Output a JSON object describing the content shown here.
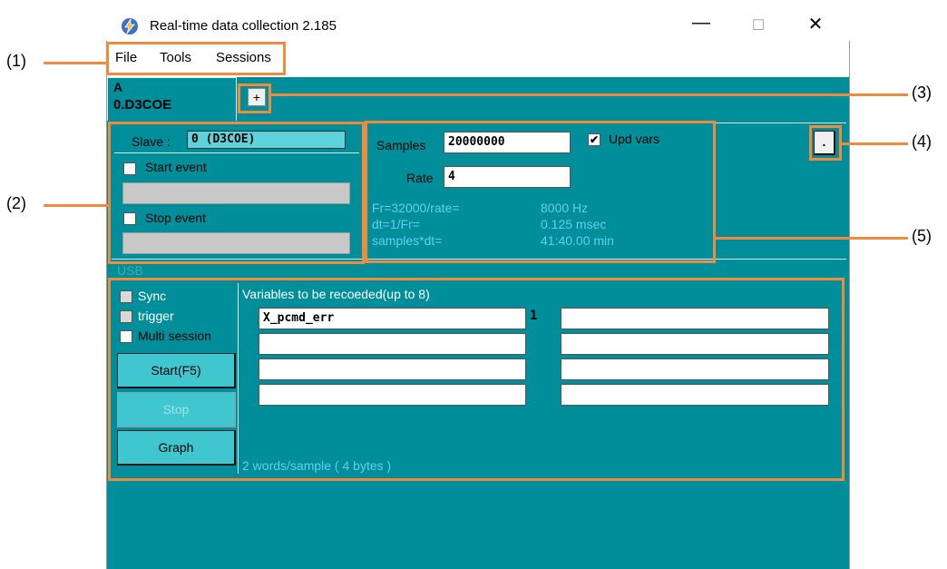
{
  "window": {
    "title": "Real-time data collection 2.185",
    "min_glyph": "—",
    "max_glyph": "☐",
    "close_glyph": "✕"
  },
  "menu": [
    "File",
    "Tools",
    "Sessions"
  ],
  "tabs": [
    {
      "line1": "A",
      "line2": "0.D3COE"
    }
  ],
  "tab_add_label": "+",
  "slave": {
    "label": "Slave :",
    "value": "0 (D3COE)"
  },
  "start_event": {
    "label": "Start event",
    "checked": false
  },
  "stop_event": {
    "label": "Stop event",
    "checked": false
  },
  "usb_label": "USB",
  "samples": {
    "label": "Samples",
    "value": "20000000"
  },
  "rate": {
    "label": "Rate",
    "value": "4"
  },
  "upd_vars": {
    "label": "Upd vars",
    "checked": true,
    "mark": "✔"
  },
  "info": {
    "row1": {
      "label": "Fr=32000/rate=",
      "value": "8000 Hz"
    },
    "row2": {
      "label": "dt=1/Fr=",
      "value": "0.125 msec"
    },
    "row3": {
      "label": "samples*dt=",
      "value": "41:40.00 min"
    }
  },
  "dot_button": ".",
  "options": {
    "sync": "Sync",
    "trigger": "trigger",
    "multi_session": "Multi session"
  },
  "buttons": {
    "start": "Start(F5)",
    "stop": "Stop",
    "graph": "Graph"
  },
  "variables": {
    "heading": "Variables to be recoeded(up to 8)",
    "slots": [
      "X_pcmd_err",
      "",
      "",
      "",
      "",
      "",
      "",
      ""
    ],
    "slot1_index": "1",
    "footer": "2 words/sample ( 4 bytes )"
  },
  "callouts": [
    "(1)",
    "(2)",
    "(3)",
    "(4)",
    "(5)"
  ],
  "colors": {
    "teal": "#008f9a",
    "accent": "#f08a3c",
    "button": "#40c6cf",
    "info_text": "#66ccee"
  }
}
